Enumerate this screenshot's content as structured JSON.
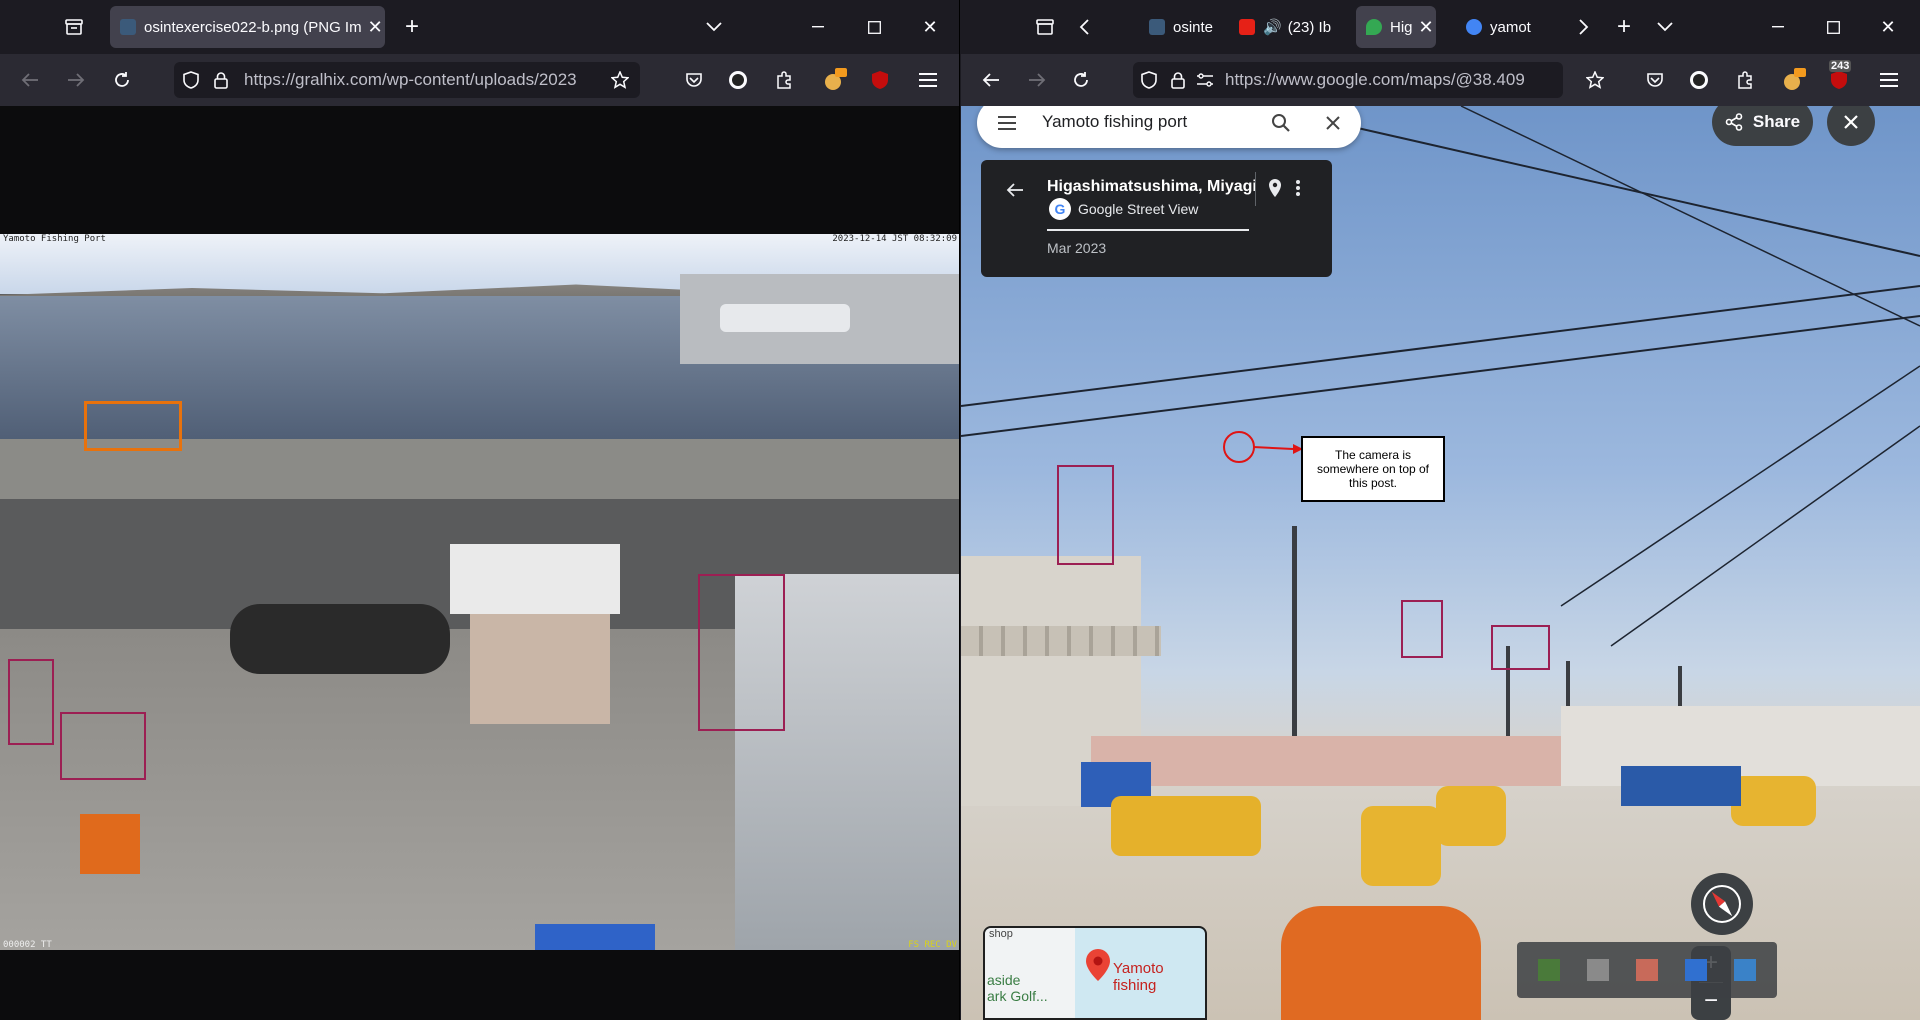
{
  "left_window": {
    "tabs": [
      {
        "title": "osintexercise022-b.png (PNG Im",
        "active": true
      }
    ],
    "url": "https://gralhix.com/wp-content/uploads/2023",
    "image": {
      "overlay_title": "Yamoto Fishing Port",
      "overlay_timestamp": "2023-12-14 JST 08:32:09",
      "overlay_bottom_left": "000002 TT",
      "overlay_bottom_right": "FS REC DV"
    }
  },
  "right_window": {
    "tabs": [
      {
        "title": "osinte",
        "active": false
      },
      {
        "title": "(23) Ib",
        "active": false
      },
      {
        "title": "Hig",
        "active": true
      },
      {
        "title": "yamot",
        "active": false
      }
    ],
    "url": "https://www.google.com/maps/@38.409",
    "badge_count": "243",
    "maps": {
      "search_value": "Yamoto fishing port",
      "place_name": "Higashimatsushima, Miyagi",
      "source": "Google Street View",
      "date": "Mar 2023",
      "share_label": "Share",
      "annotation_text": "The camera is somewhere on top of this post.",
      "minimap_label": "Yamoto fishing",
      "minimap_shop": "shop",
      "minimap_park": "aside\nark Golf..."
    }
  },
  "colors": {
    "toolbar_bg": "#2b2a33",
    "tabbar_bg": "#1c1b22",
    "active_tab": "#42414d",
    "highlight_box": "#9c1f53",
    "orange_box": "#e8720c",
    "annotation_arrow": "#e01414"
  }
}
